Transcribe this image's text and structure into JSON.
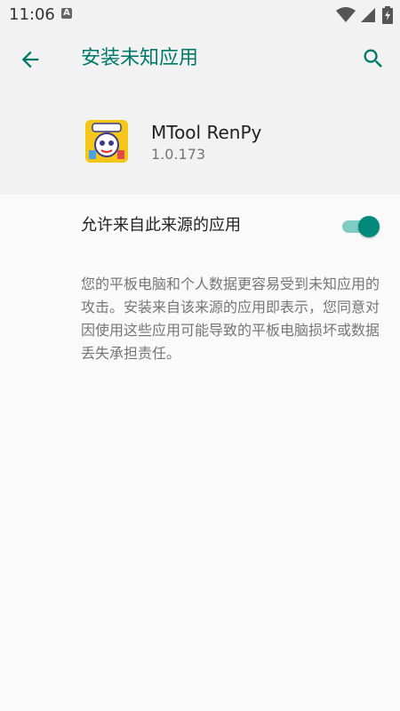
{
  "status_bar": {
    "time": "11:06",
    "notification_icon": "a-icon",
    "indicators": [
      "wifi-icon",
      "signal-icon",
      "battery-icon"
    ]
  },
  "app_bar": {
    "title": "安装未知应用",
    "back_icon": "arrow-left-icon",
    "search_icon": "search-icon",
    "accent_color": "#00796b"
  },
  "app": {
    "name": "MTool RenPy",
    "version": "1.0.173",
    "icon": "renpy-app-icon"
  },
  "setting": {
    "label": "允许来自此来源的应用",
    "enabled": true,
    "toggle_color": "#00897b"
  },
  "warning": {
    "text": "您的平板电脑和个人数据更容易受到未知应用的攻击。安装来自该来源的应用即表示，您同意对因使用这些应用可能导致的平板电脑损坏或数据丢失承担责任。"
  }
}
